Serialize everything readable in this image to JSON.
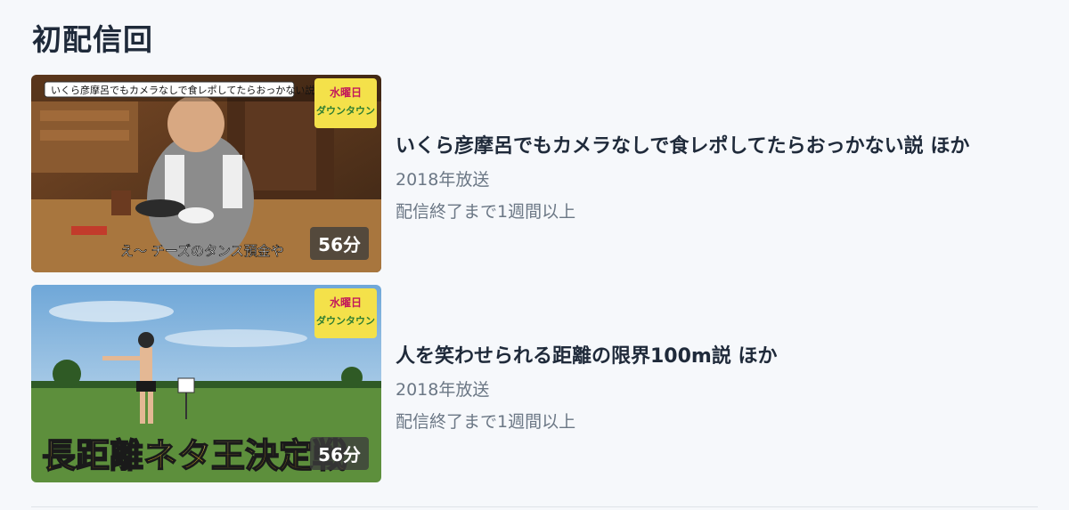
{
  "section": {
    "title": "初配信回"
  },
  "episodes": [
    {
      "title": "いくら彦摩呂でもカメラなしで食レポしてたらおっかない説 ほか",
      "year": "2018年放送",
      "availability": "配信終了まで1週間以上",
      "duration": "56分",
      "thumbnail": {
        "top_caption": "いくら彦摩呂でもカメラなしで食レポしてたらおっかない説",
        "bottom_caption": "え～ チーズのタンス預金や",
        "logo_top": "水曜日",
        "logo_bottom": "ダウンタウン"
      }
    },
    {
      "title": "人を笑わせられる距離の限界100m説 ほか",
      "year": "2018年放送",
      "availability": "配信終了まで1週間以上",
      "duration": "56分",
      "thumbnail": {
        "banner": "長距離ネタ王決定戦",
        "logo_top": "水曜日",
        "logo_bottom": "ダウンタウン"
      }
    }
  ]
}
